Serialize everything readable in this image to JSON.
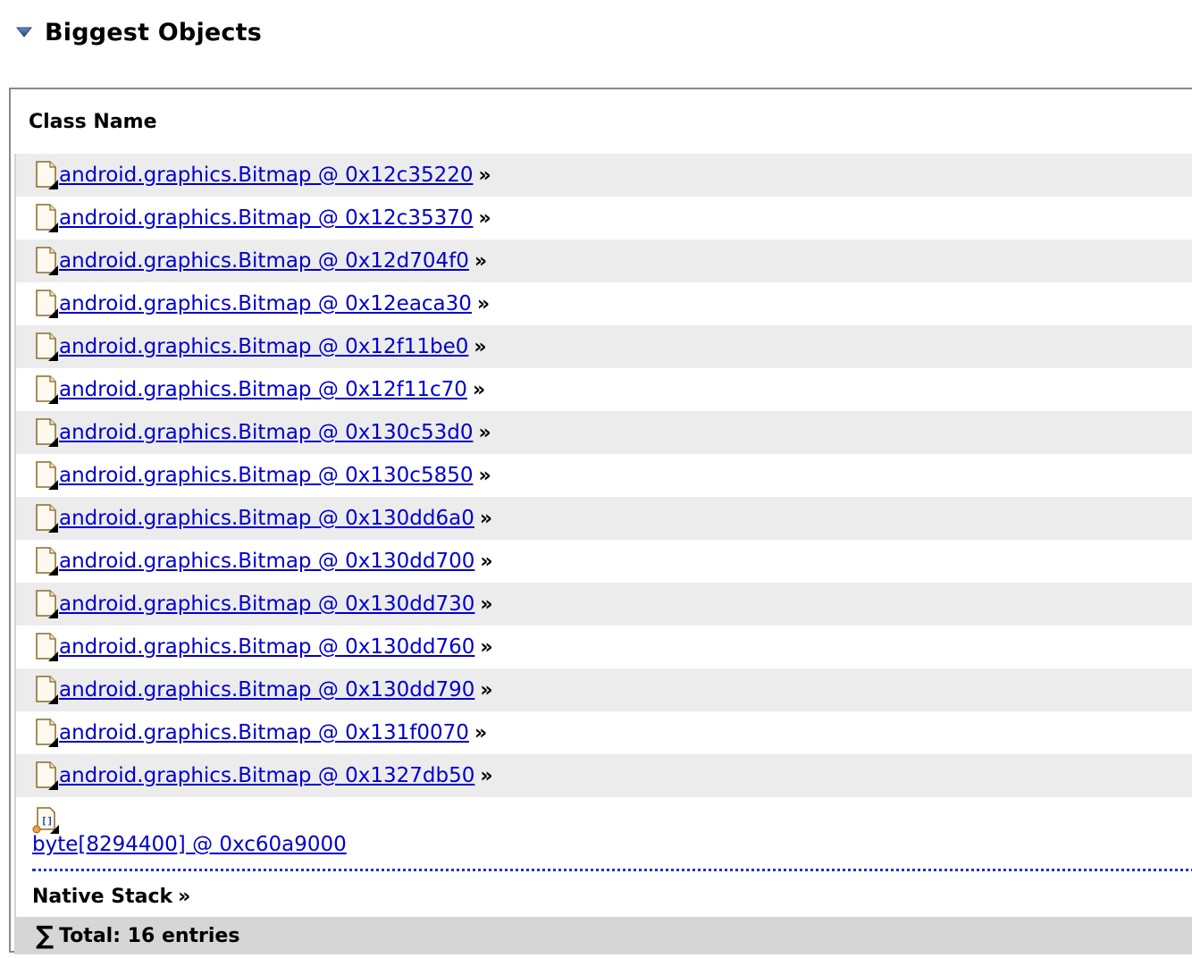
{
  "section": {
    "title": "Biggest Objects"
  },
  "table": {
    "column_header": "Class Name",
    "rows": [
      {
        "label": "android.graphics.Bitmap @ 0x12c35220"
      },
      {
        "label": "android.graphics.Bitmap @ 0x12c35370"
      },
      {
        "label": "android.graphics.Bitmap @ 0x12d704f0"
      },
      {
        "label": "android.graphics.Bitmap @ 0x12eaca30"
      },
      {
        "label": "android.graphics.Bitmap @ 0x12f11be0"
      },
      {
        "label": "android.graphics.Bitmap @ 0x12f11c70"
      },
      {
        "label": "android.graphics.Bitmap @ 0x130c53d0"
      },
      {
        "label": "android.graphics.Bitmap @ 0x130c5850"
      },
      {
        "label": "android.graphics.Bitmap @ 0x130dd6a0"
      },
      {
        "label": "android.graphics.Bitmap @ 0x130dd700"
      },
      {
        "label": "android.graphics.Bitmap @ 0x130dd730"
      },
      {
        "label": "android.graphics.Bitmap @ 0x130dd760"
      },
      {
        "label": "android.graphics.Bitmap @ 0x130dd790"
      },
      {
        "label": "android.graphics.Bitmap @ 0x131f0070"
      },
      {
        "label": "android.graphics.Bitmap @ 0x1327db50"
      }
    ],
    "row_suffix": "»",
    "byte_entry": {
      "label": "byte[8294400] @ 0xc60a9000",
      "icon_text": "[]"
    },
    "native_stack": {
      "label": "Native Stack",
      "suffix": "»"
    },
    "total": {
      "symbol": "∑",
      "label": "Total: 16 entries"
    }
  }
}
